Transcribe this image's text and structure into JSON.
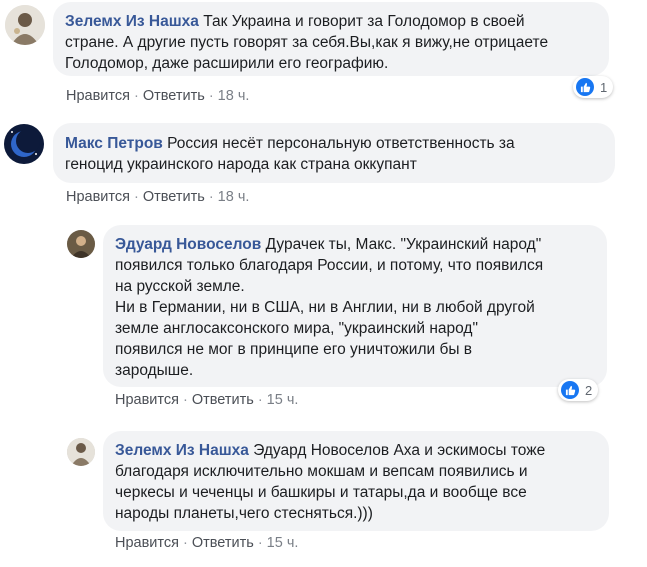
{
  "accent_color": "#385898",
  "like_color": "#1877f2",
  "comments": [
    {
      "author": "Зелемх Из Нашха",
      "lines": [
        "Так Украина и говорит за Голодомор в своей",
        "стране. А другие пусть говорят за себя.Вы,как я вижу,не отрицаете",
        "Голодомор, даже расширили его географию."
      ],
      "like_label": "Нравится",
      "reply_label": "Ответить",
      "time": "18 ч.",
      "reaction_icon": "thumbs-up-icon",
      "reactions": "1"
    },
    {
      "author": "Макс Петров",
      "lines": [
        "Россия несёт персональную ответственность за",
        "геноцид украинского народа как страна оккупант"
      ],
      "like_label": "Нравится",
      "reply_label": "Ответить",
      "time": "18 ч."
    },
    {
      "author": "Эдуард Новоселов",
      "lines": [
        "Дурачек ты, Макс. \"Украинский народ\"",
        "появился только благодаря России, и потому, что появился",
        "на русской земле.",
        "Ни в Германии, ни в США, ни в Англии, ни в любой другой",
        "земле англосаксонского мира, \"украинский народ\"",
        "появился не мог в принципе его уничтожили бы в",
        "зародыше."
      ],
      "like_label": "Нравится",
      "reply_label": "Ответить",
      "time": "15 ч.",
      "reaction_icon": "thumbs-up-icon",
      "reactions": "2"
    },
    {
      "author": "Зелемх Из Нашха",
      "lines": [
        "Эдуард Новоселов Аха и эскимосы тоже",
        "благодаря исключительно мокшам и вепсам появились и",
        "черкесы и чеченцы и башкиры и татары,да и вообще все",
        "народы планеты,чего стесняться.)))"
      ],
      "like_label": "Нравится",
      "reply_label": "Ответить",
      "time": "15 ч."
    }
  ]
}
